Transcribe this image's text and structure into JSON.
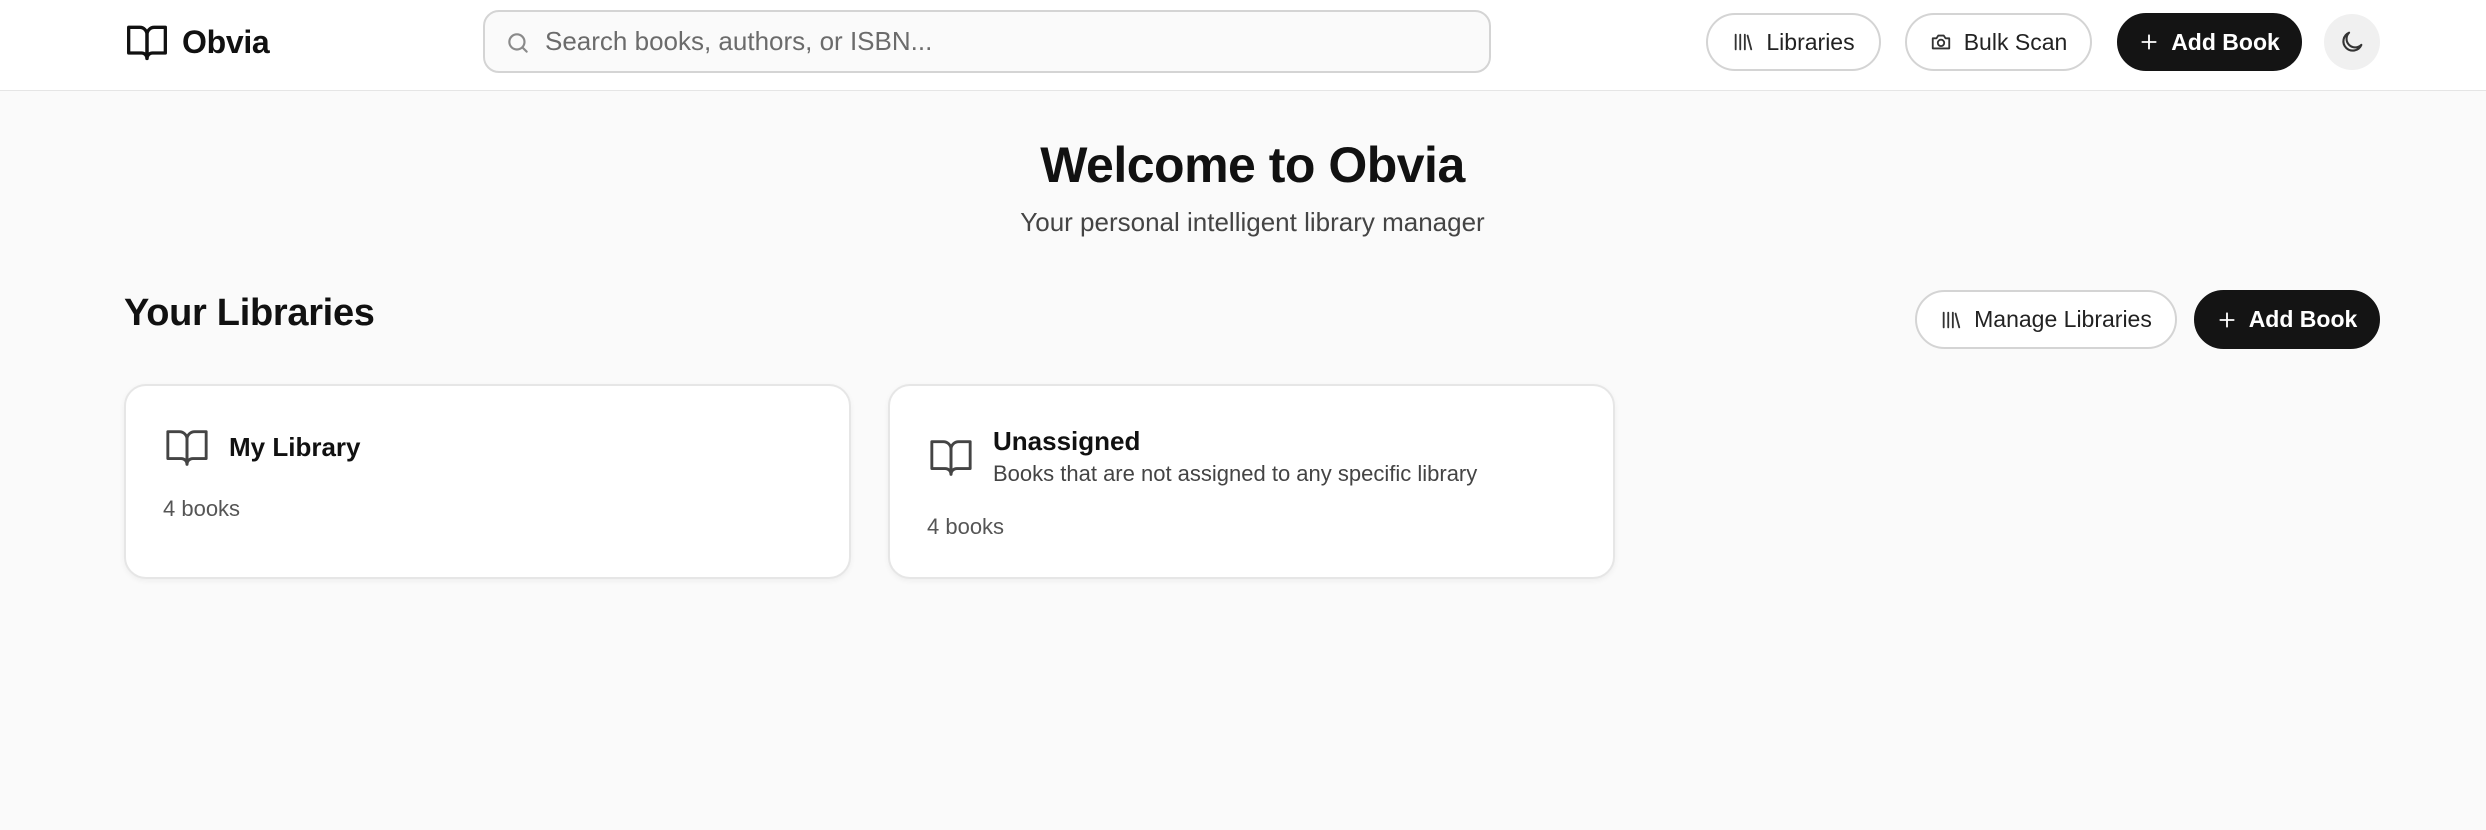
{
  "app": {
    "name": "Obvia"
  },
  "search": {
    "placeholder": "Search books, authors, or ISBN...",
    "value": ""
  },
  "header": {
    "libraries_label": "Libraries",
    "bulk_scan_label": "Bulk Scan",
    "add_book_label": "Add Book",
    "theme_toggle_icon": "moon-icon"
  },
  "hero": {
    "title": "Welcome to Obvia",
    "subtitle": "Your personal intelligent library manager"
  },
  "libraries_section": {
    "title": "Your Libraries",
    "manage_label": "Manage Libraries",
    "add_book_label": "Add Book",
    "cards": [
      {
        "name": "My Library",
        "description": "",
        "count": "4 books",
        "icon": "book-open-icon"
      },
      {
        "name": "Unassigned",
        "description": "Books that are not assigned to any specific library",
        "count": "4 books",
        "icon": "book-open-icon"
      }
    ]
  },
  "colors": {
    "background": "#fafafa",
    "surface": "#ffffff",
    "primary_button": "#141414",
    "border": "#d4d4d4",
    "text": "#111111",
    "muted_text": "#555555"
  }
}
